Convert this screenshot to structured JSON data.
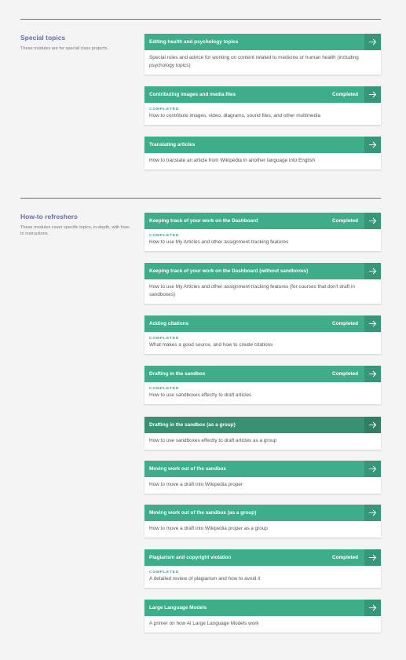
{
  "arrow_icon": "arrow-right-icon",
  "colors": {
    "accent": "#3eae8a",
    "accent_dark": "#369273",
    "section_title": "#676eb4"
  },
  "special_topics": {
    "title": "Special topics",
    "description": "These modules are for special class projects.",
    "modules": [
      {
        "title": "Editing health and psychology topics",
        "status": "",
        "completed_label": "",
        "description": "Special rules and advice for working on content related to medicine or human health (including psychology topics)"
      },
      {
        "title": "Contributing images and media files",
        "status": "Completed",
        "completed_label": "COMPLETED",
        "description": "How to contribute images, video, diagrams, sound files, and other multimedia"
      },
      {
        "title": "Translating articles",
        "status": "",
        "completed_label": "",
        "description": "How to translate an article from Wikipedia in another language into English"
      }
    ]
  },
  "howto": {
    "title": "How-to refreshers",
    "description": "These modules cover specific topics, in-depth, with how-to instructions.",
    "modules": [
      {
        "title": "Keeping track of your work on the Dashboard",
        "status": "Completed",
        "completed_label": "COMPLETED",
        "description": "How to use My Articles and other assignment-tracking features"
      },
      {
        "title": "Keeping track of your work on the Dashboard (without sandboxes)",
        "status": "",
        "completed_label": "",
        "description": "How to use My Articles and other assignment-tracking features (for courses that don't draft in sandboxes)"
      },
      {
        "title": "Adding citations",
        "status": "Completed",
        "completed_label": "COMPLETED",
        "description": "What makes a good source, and how to create citations"
      },
      {
        "title": "Drafting in the sandbox",
        "status": "Completed",
        "completed_label": "COMPLETED",
        "description": "How to use sandboxes effectly to draft articles"
      },
      {
        "title": "Drafting in the sandbox (as a group)",
        "status": "",
        "completed_label": "",
        "description": "How to use sandboxes effectly to draft articles as a group"
      },
      {
        "title": "Moving work out of the sandbox",
        "status": "",
        "completed_label": "",
        "description": "How to move a draft into Wikipedia proper"
      },
      {
        "title": "Moving work out of the sandbox (as a group)",
        "status": "",
        "completed_label": "",
        "description": "How to move a draft into Wikipedia proper as a group"
      },
      {
        "title": "Plagiarism and copyright violation",
        "status": "Completed",
        "completed_label": "COMPLETED",
        "description": "A detailed review of plagiarism and how to avoid it"
      },
      {
        "title": "Large Language Models",
        "status": "",
        "completed_label": "",
        "description": "A primer on how AI Large Language Models work"
      }
    ]
  }
}
